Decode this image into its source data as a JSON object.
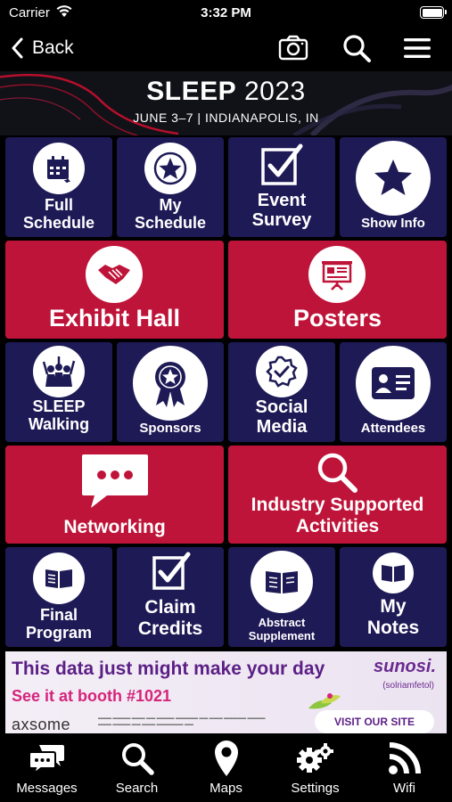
{
  "status_bar": {
    "carrier": "Carrier",
    "time": "3:32 PM",
    "battery_level": 1.0
  },
  "nav": {
    "back_label": "Back"
  },
  "banner": {
    "title_bold": "SLEEP",
    "title_year": "2023",
    "subtitle": "JUNE 3–7 | INDIANAPOLIS, IN",
    "accent_color": "#c8102e"
  },
  "colors": {
    "tile_blue": "#1e1a56",
    "tile_red": "#bf1439"
  },
  "tiles": {
    "full_schedule": {
      "line1": "Full",
      "line2": "Schedule",
      "icon": "calendar-icon"
    },
    "my_schedule": {
      "line1": "My",
      "line2": "Schedule",
      "icon": "star-icon"
    },
    "event_survey": {
      "line1": "Event",
      "line2": "Survey",
      "icon": "checkbox-icon"
    },
    "show_info": {
      "label": "Show Info",
      "icon": "star-icon"
    },
    "exhibit_hall": {
      "label": "Exhibit Hall",
      "icon": "handshake-icon"
    },
    "posters": {
      "label": "Posters",
      "icon": "presentation-board-icon"
    },
    "sleep_walking": {
      "line1": "SLEEP",
      "line2": "Walking",
      "icon": "crowd-icon"
    },
    "sponsors": {
      "label": "Sponsors",
      "icon": "award-ribbon-icon"
    },
    "social_media": {
      "line1": "Social",
      "line2": "Media",
      "icon": "verified-badge-icon"
    },
    "attendees": {
      "label": "Attendees",
      "icon": "id-card-icon"
    },
    "networking": {
      "label": "Networking",
      "icon": "chat-bubble-icon"
    },
    "industry_supported": {
      "line1": "Industry Supported",
      "line2": "Activities",
      "icon": "search-icon"
    },
    "final_program": {
      "line1": "Final",
      "line2": "Program",
      "icon": "book-icon"
    },
    "claim_credits": {
      "line1": "Claim",
      "line2": "Credits",
      "icon": "checkbox-icon"
    },
    "abstract_supplement": {
      "line1": "Abstract",
      "line2": "Supplement",
      "icon": "book-icon"
    },
    "my_notes": {
      "line1": "My",
      "line2": "Notes",
      "icon": "book-icon"
    }
  },
  "ad": {
    "headline": "This data just might make your day",
    "booth": "See it at booth #1021",
    "brand": "sunosi.",
    "generic": "(solriamfetol)",
    "cta": "VISIT OUR SITE",
    "company": "axsome"
  },
  "tabs": [
    {
      "label": "Messages",
      "icon": "messages-icon"
    },
    {
      "label": "Search",
      "icon": "search-icon"
    },
    {
      "label": "Maps",
      "icon": "map-pin-icon"
    },
    {
      "label": "Settings",
      "icon": "gear-icon"
    },
    {
      "label": "Wifi",
      "icon": "wifi-icon"
    }
  ]
}
